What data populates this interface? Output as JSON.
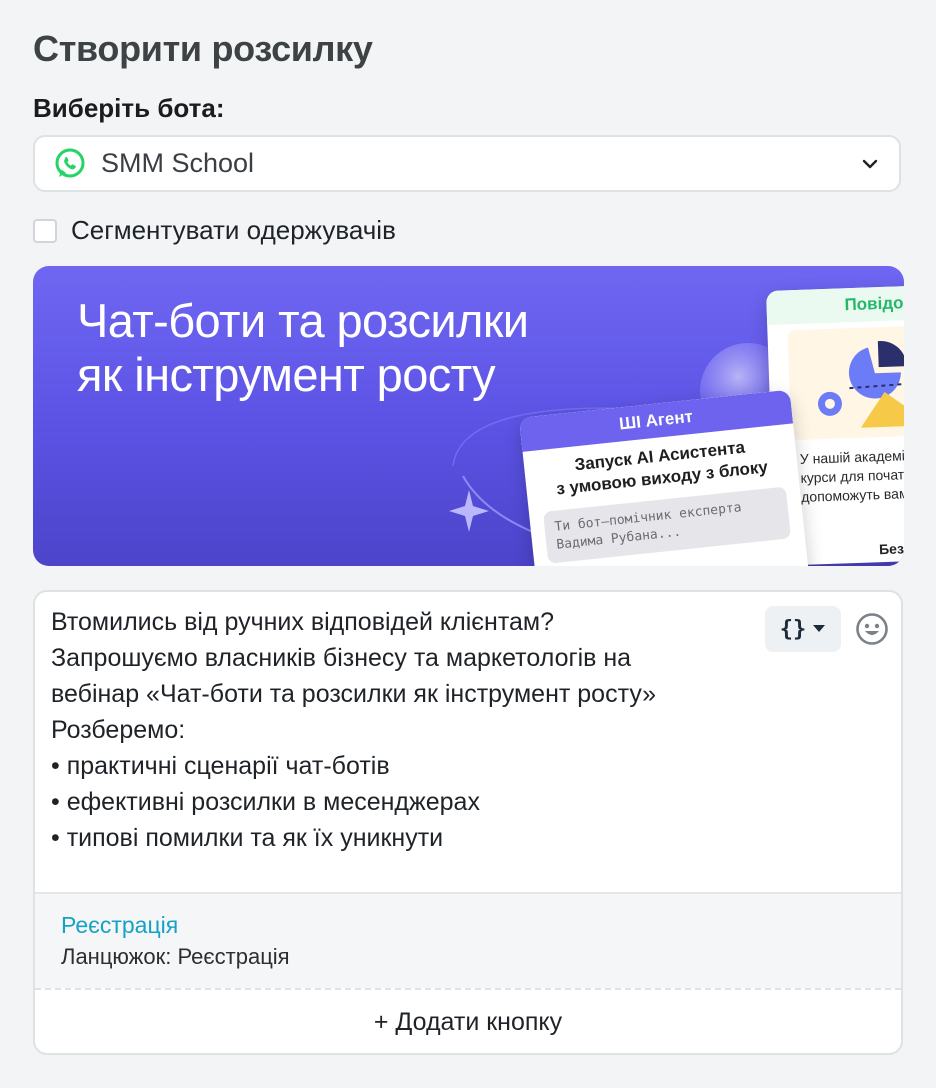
{
  "page": {
    "title": "Створити розсилку"
  },
  "bot": {
    "label": "Виберіть бота:",
    "selected": "SMM School",
    "icon": "whatsapp-icon",
    "icon_color": "#25D366"
  },
  "segment": {
    "label": "Сегментувати одержувачів",
    "checked": false
  },
  "banner": {
    "title_line1": "Чат-боти та розсилки",
    "title_line2": "як інструмент росту",
    "card_agent": {
      "header": "ШІ Агент",
      "title_line1": "Запуск AI Асистента",
      "title_line2": "з умовою виходу з блоку",
      "snippet_line1": "Ти бот—помічник експерта",
      "snippet_line2": "Вадима Рубана..."
    },
    "card_message": {
      "header": "Повідомлення",
      "text_line1": "У нашій академії",
      "text_line2": "курси для початківців",
      "text_line3": "допоможуть вам",
      "footer": "Безплатно"
    },
    "accent_color": "#5b52e4"
  },
  "editor": {
    "message": "Втомились від ручних відповідей клієнтам?\nЗапрошуємо власників бізнесу та маркетологів на\nвебінар «Чат-боти та розсилки як інструмент росту»\nРозберемо:\n • практичні сценарії чат-ботів\n • ефективні розсилки в месенджерах\n • типові помилки та як їх уникнути",
    "variable_button_label": "{}",
    "buttons": [
      {
        "label": "Реєстрація",
        "action": "Ланцюжок: Реєстрація",
        "label_color": "#17a1c4"
      }
    ],
    "add_button_label": "+ Додати кнопку"
  }
}
